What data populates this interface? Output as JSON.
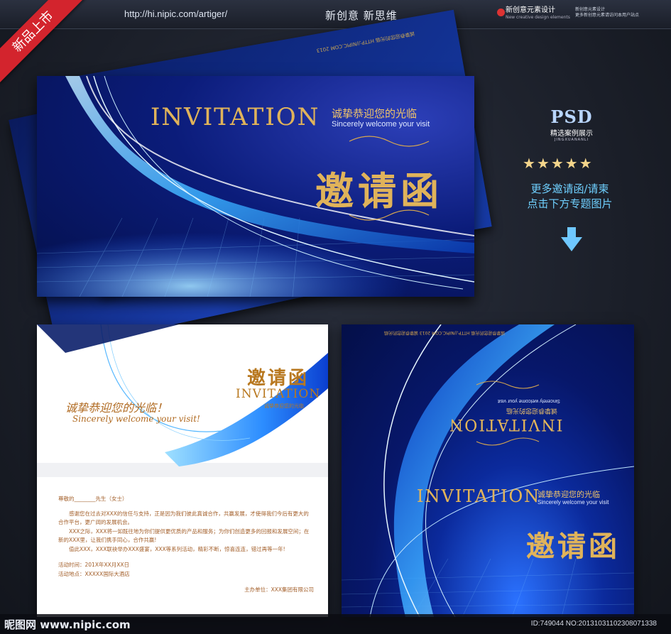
{
  "header": {
    "url": "http://hi.nipic.com/artiger/",
    "slogan": "新创意  新思维",
    "brand_name": "新创意元素设计",
    "brand_sub": "New creative design elements",
    "brand_note_1": "新创意元素设计",
    "brand_note_2": "更多新创意元素请访问本用户站点"
  },
  "ribbon": "新品上市",
  "main_card": {
    "title": "INVITATION",
    "cn_sub": "诚挚恭迎您的光临",
    "en_sub": "Sincerely welcome your visit",
    "cn_big": "邀请函"
  },
  "back_card": {
    "mirrored_text": "诚挚恭迎您的光临 HTTP://NIPIC.COM 2013"
  },
  "white_card": {
    "cn_big": "邀请函",
    "title": "INVITATION",
    "cn_small": "诚挚恭迎您的光临",
    "script_cn": "诚挚恭迎您的光临！",
    "script_en": "Sincerely welcome your visit!",
    "greeting": "尊敬的________先生（女士）",
    "para1": "感谢您在过去对XXX的信任与支持，正是因为我们彼此真诚合作，共赢发展，才使得我们今后有更大的合作平台，更广阔的发展机会。",
    "para2": "XXX之际，XXX将一如既往地为你们提供更优质的产品和服务；为你们创造更多的回报和发展空间；在新的XXX里，让我们携手同心，合作共赢!",
    "para3": "值此XXX，XXX联袂举办XXX盛宴，XXX等系列活动，精彩不断，惊喜连连，错过再等一年!",
    "time": "活动时间：201X年XX月XX日",
    "place": "活动地点：XXXXX国际大酒店",
    "host": "主办单位：XXX集团有限公司"
  },
  "square_card": {
    "mirror_title": "INVITATION",
    "mirror_cn": "诚挚恭迎您的光临",
    "mirror_en": "Sincerely welcome your visit",
    "top_strip": "诚挚恭迎您的光临 HTTP://NIPIC.COM 2013 诚挚恭迎您的光临",
    "title": "INVITATION",
    "cn_sub": "诚挚恭迎您的光临",
    "en_sub": "Sincerely welcome your visit",
    "cn_big": "邀请函"
  },
  "promo": {
    "psd": "PSD",
    "psd_sub": "精选案例展示",
    "psd_tiny": "JINGXUANANLI",
    "stars": "★★★★★",
    "line1": "更多邀请函/请柬",
    "line2": "点击下方专题图片"
  },
  "footer": {
    "site": "昵图网 www.nipic.com",
    "id": "ID:749044 NO:20131031102308071338"
  },
  "colors": {
    "gold": "#e0b35a",
    "deep_blue": "#04104a",
    "bright_blue": "#2b72ff",
    "ribbon_red": "#d3242d"
  }
}
